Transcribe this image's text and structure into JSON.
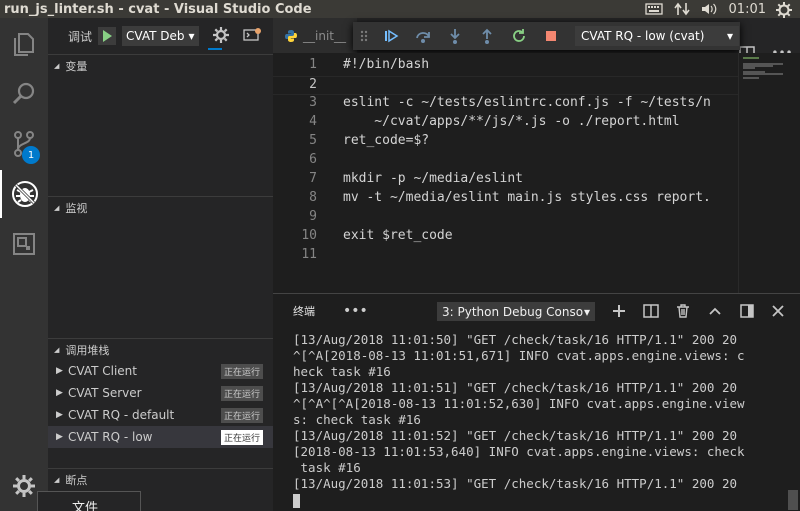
{
  "window": {
    "title": "run_js_linter.sh - cvat - Visual Studio Code",
    "clock": "01:01"
  },
  "sidebar": {
    "debug_label": "调试",
    "config_select": "CVAT Deb",
    "sections": {
      "variables": "变量",
      "watch": "监视",
      "call_stack": "调用堆栈",
      "breakpoints": "断点"
    },
    "call_stack_items": [
      {
        "label": "CVAT Client",
        "state": "正在运行",
        "selected": false
      },
      {
        "label": "CVAT Server",
        "state": "正在运行",
        "selected": false
      },
      {
        "label": "CVAT RQ - default",
        "state": "正在运行",
        "selected": false
      },
      {
        "label": "CVAT RQ - low",
        "state": "正在运行",
        "selected": true
      }
    ]
  },
  "activity": {
    "scm_badge": "1"
  },
  "editor": {
    "tab_label": "__init__",
    "debug_target_select": "CVAT RQ - low (cvat)",
    "lines": [
      {
        "num": "1",
        "text": "#!/bin/bash"
      },
      {
        "num": "2",
        "text": ""
      },
      {
        "num": "3",
        "text": "eslint -c ~/tests/eslintrc.conf.js -f ~/tests/n"
      },
      {
        "num": "4",
        "text": "    ~/cvat/apps/**/js/*.js -o ./report.html"
      },
      {
        "num": "5",
        "text": "ret_code=$?"
      },
      {
        "num": "6",
        "text": ""
      },
      {
        "num": "7",
        "text": "mkdir -p ~/media/eslint"
      },
      {
        "num": "8",
        "text": "mv -t ~/media/eslint main.js styles.css report."
      },
      {
        "num": "9",
        "text": ""
      },
      {
        "num": "10",
        "text": "exit $ret_code"
      },
      {
        "num": "11",
        "text": ""
      }
    ]
  },
  "panel": {
    "tab_terminal": "终端",
    "more": "•••",
    "terminal_select": "3: Python Debug Conso",
    "terminal_lines": [
      "[13/Aug/2018 11:01:50] \"GET /check/task/16 HTTP/1.1\" 200 20",
      "^[^A[2018-08-13 11:01:51,671] INFO cvat.apps.engine.views: c",
      "heck task #16",
      "[13/Aug/2018 11:01:51] \"GET /check/task/16 HTTP/1.1\" 200 20",
      "^[^A^[^A[2018-08-13 11:01:52,630] INFO cvat.apps.engine.view",
      "s: check task #16",
      "[13/Aug/2018 11:01:52] \"GET /check/task/16 HTTP/1.1\" 200 20",
      "[2018-08-13 11:01:53,640] INFO cvat.apps.engine.views: check",
      " task #16",
      "[13/Aug/2018 11:01:53] \"GET /check/task/16 HTTP/1.1\" 200 20"
    ]
  },
  "tooltip": {
    "text": "文件"
  }
}
